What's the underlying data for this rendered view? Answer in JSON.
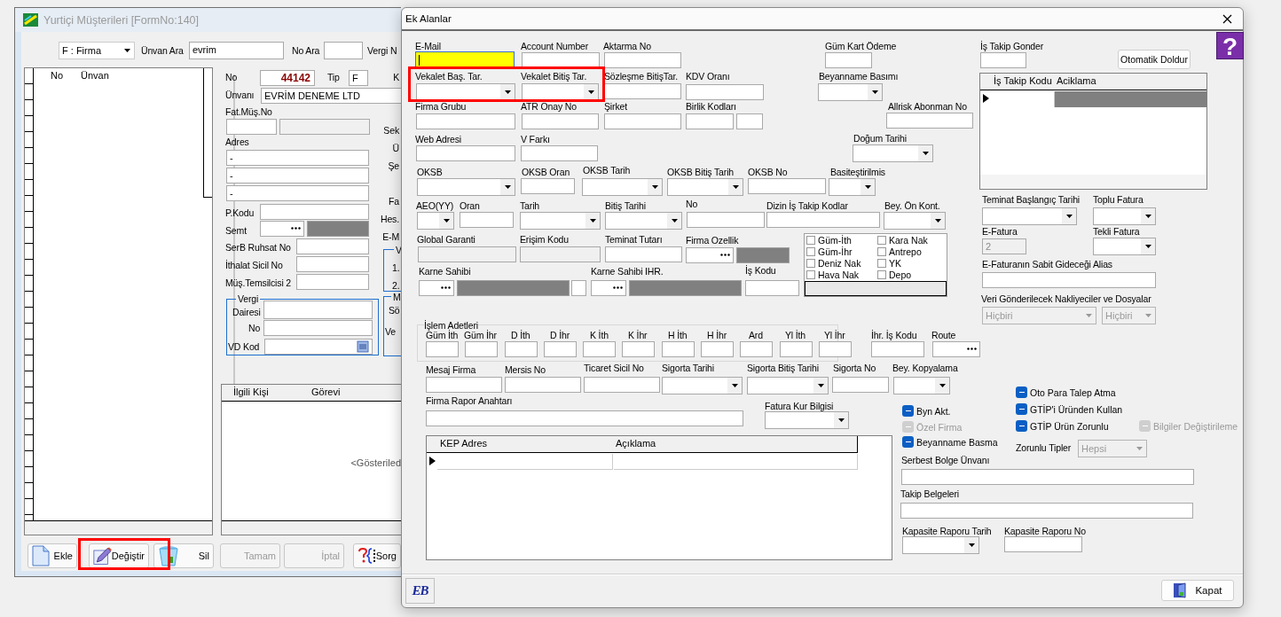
{
  "main_window": {
    "title": "Yurtiçi Müşterileri [FormNo:140]",
    "toolbar": {
      "type_combo": "F : Firma",
      "search_label": "Ünvan Ara",
      "search_value": "evrim",
      "no_label": "No Ara",
      "tax_label": "Vergi N"
    },
    "customer_grid": {
      "columns": [
        "No",
        "Ünvan"
      ]
    },
    "detail_fields": [
      {
        "label": "No",
        "kind": "number",
        "value": "44142"
      },
      {
        "label": "Tip",
        "kind": "text",
        "value": "F"
      },
      {
        "label": "Ünvanı",
        "kind": "text",
        "value": "EVRİM DENEME LTD"
      },
      {
        "label": "Fat.Müş.No",
        "kind": "pair_disabled"
      },
      {
        "label": "Adres",
        "kind": "multi",
        "values": [
          "-",
          "-",
          "-"
        ]
      },
      {
        "label": "P.Kodu",
        "kind": "text"
      },
      {
        "label": "Semt",
        "kind": "lookup_block"
      },
      {
        "label": "SerB Ruhsat No",
        "kind": "text"
      },
      {
        "label": "İthalat Sicil No",
        "kind": "text"
      },
      {
        "label": "Müş.Temsilcisi 2",
        "kind": "text"
      }
    ],
    "tax_group": {
      "title": "Vergi",
      "office_label": "Dairesi",
      "no_label": "No",
      "code_label": "VD Kod"
    },
    "cut_labels": [
      "K",
      "Sek",
      "Ü",
      "Şe",
      "Fa",
      "Hes.",
      "E-M"
    ],
    "side_groups": [
      {
        "title": "V",
        "lines": [
          "1.",
          "2."
        ]
      },
      {
        "title": "M",
        "lines": [
          "Sö",
          "Ve"
        ]
      }
    ],
    "contacts_grid": {
      "columns": [
        "İlgili Kişi",
        "Görevi"
      ],
      "empty_text": "<Gösteriled"
    },
    "buttons": [
      {
        "label": "Ekle",
        "disabled": false
      },
      {
        "label": "Değiştir",
        "disabled": false
      },
      {
        "label": "Sil",
        "disabled": false
      },
      {
        "label": "Tamam",
        "disabled": true
      },
      {
        "label": "İptal",
        "disabled": true
      },
      {
        "label": "Sorg",
        "disabled": false
      }
    ]
  },
  "dialog": {
    "title": "Ek Alanlar",
    "help": "?",
    "auto_fill_button": "Otomatik Doldur",
    "fields": [
      {
        "label": "E-Mail",
        "kind": "text",
        "focused": true
      },
      {
        "label": "Account Number",
        "kind": "text"
      },
      {
        "label": "Aktarma No",
        "kind": "text"
      },
      {
        "label": "Güm Kart Ödeme",
        "kind": "text"
      },
      {
        "label": "İş Takip Gonder",
        "kind": "text"
      },
      {
        "label": "Vekalet Baş. Tar.",
        "kind": "combo"
      },
      {
        "label": "Vekalet Bitiş Tar.",
        "kind": "combo"
      },
      {
        "label": "Sözleşme BitişTar.",
        "kind": "text"
      },
      {
        "label": "KDV Oranı",
        "kind": "text"
      },
      {
        "label": "Beyanname Basımı",
        "kind": "combo"
      },
      {
        "label": "Firma Grubu",
        "kind": "text"
      },
      {
        "label": "ATR Onay No",
        "kind": "text"
      },
      {
        "label": "Şirket",
        "kind": "text"
      },
      {
        "label": "Birlik Kodları",
        "kind": "pair"
      },
      {
        "label": "Allrisk Abonman No",
        "kind": "text"
      },
      {
        "label": "Web Adresi",
        "kind": "text"
      },
      {
        "label": "V Farkı",
        "kind": "text"
      },
      {
        "label": "Doğum Tarihi",
        "kind": "combo"
      },
      {
        "label": "OKSB",
        "kind": "combo"
      },
      {
        "label": "OKSB Oran",
        "kind": "text"
      },
      {
        "label": "OKSB Tarih",
        "kind": "combo"
      },
      {
        "label": "OKSB Bitiş Tarih",
        "kind": "combo"
      },
      {
        "label": "OKSB No",
        "kind": "text"
      },
      {
        "label": "Basiteştirilmis",
        "kind": "combo"
      },
      {
        "label": "AEO(YY)",
        "kind": "combo"
      },
      {
        "label": "Oran",
        "kind": "text"
      },
      {
        "label": "Tarih",
        "kind": "combo"
      },
      {
        "label": "Bitiş Tarihi",
        "kind": "combo"
      },
      {
        "label": "No",
        "kind": "text"
      },
      {
        "label": "Dizin İş Takip Kodlar",
        "kind": "text"
      },
      {
        "label": "Bey. Ön Kont.",
        "kind": "combo"
      },
      {
        "label": "Global Garanti",
        "kind": "disabled"
      },
      {
        "label": "Erişim Kodu",
        "kind": "disabled"
      },
      {
        "label": "Teminat Tutarı",
        "kind": "text"
      },
      {
        "label": "Firma Ozellik",
        "kind": "lookup_block"
      },
      {
        "label": "Karne Sahibi",
        "kind": "lookup_block"
      },
      {
        "label": "Karne Sahibi IHR.",
        "kind": "lookup_block"
      },
      {
        "label": "İş Kodu",
        "kind": "text"
      },
      {
        "label": "Teminat Başlangıç Tarihi",
        "kind": "combo"
      },
      {
        "label": "Toplu Fatura",
        "kind": "combo"
      },
      {
        "label": "E-Fatura",
        "kind": "disabled",
        "value": "2"
      },
      {
        "label": "Tekli Fatura",
        "kind": "combo"
      },
      {
        "label": "E-Faturanın Sabit Gideceği Alias",
        "kind": "text"
      },
      {
        "label": "Veri Gönderilecek Nakliyeciler ve Dosyalar",
        "kind": "disabled_combo",
        "values": [
          "Hiçbiri",
          "Hiçbiri"
        ]
      },
      {
        "label": "İhr. İş Kodu",
        "kind": "text"
      },
      {
        "label": "Route",
        "kind": "lookup"
      },
      {
        "label": "Mesaj Firma",
        "kind": "text"
      },
      {
        "label": "Mersis No",
        "kind": "text"
      },
      {
        "label": "Ticaret Sicil No",
        "kind": "text"
      },
      {
        "label": "Sigorta Tarihi",
        "kind": "combo"
      },
      {
        "label": "Sigorta Bitiş Tarihi",
        "kind": "combo"
      },
      {
        "label": "Sigorta No",
        "kind": "text"
      },
      {
        "label": "Bey. Kopyalama",
        "kind": "combo"
      },
      {
        "label": "Firma Rapor Anahtarı",
        "kind": "text"
      },
      {
        "label": "Fatura Kur Bilgisi",
        "kind": "combo"
      },
      {
        "label": "Zorunlu Tipler",
        "kind": "disabled_combo",
        "values": [
          "Hepsi"
        ]
      },
      {
        "label": "Serbest Bolge Ünvanı",
        "kind": "text"
      },
      {
        "label": "Takip Belgeleri",
        "kind": "text"
      },
      {
        "label": "Kapasite Raporu Tarih",
        "kind": "combo"
      },
      {
        "label": "Kapasite Raporu No",
        "kind": "text"
      }
    ],
    "job_grid": {
      "columns": [
        "İş Takip Kodu",
        "Aciklama"
      ]
    },
    "counts_group": {
      "title": "İşlem Adetleri",
      "labels": [
        "Güm İth",
        "Güm İhr",
        "D İth",
        "D İhr",
        "K İth",
        "K İhr",
        "H İth",
        "H İhr",
        "Ard",
        "Yl İth",
        "Yl İhr"
      ]
    },
    "checkbox_panel": [
      {
        "label": "Güm-İth",
        "checked": false
      },
      {
        "label": "Güm-İhr",
        "checked": false
      },
      {
        "label": "Deniz Nak",
        "checked": false
      },
      {
        "label": "Hava Nak",
        "checked": false
      },
      {
        "label": "Kara Nak",
        "checked": false
      },
      {
        "label": "Antrepo",
        "checked": false
      },
      {
        "label": "YK",
        "checked": false
      },
      {
        "label": "Depo",
        "checked": false
      }
    ],
    "toggles": [
      {
        "label": "Byn Akt.",
        "disabled": false
      },
      {
        "label": "Özel Firma",
        "disabled": true
      },
      {
        "label": "Beyanname Basma",
        "disabled": false
      },
      {
        "label": "Oto Para Talep Atma",
        "disabled": false
      },
      {
        "label": "GTİP'i Üründen Kullan",
        "disabled": false
      },
      {
        "label": "GTİP Ürün Zorunlu",
        "disabled": false
      },
      {
        "label": "Bilgiler Değiştirileme",
        "disabled": true
      }
    ],
    "kep_grid": {
      "columns": [
        "KEP Adres",
        "Açıklama"
      ]
    },
    "footer_logo": "EB",
    "close_button": "Kapat"
  }
}
